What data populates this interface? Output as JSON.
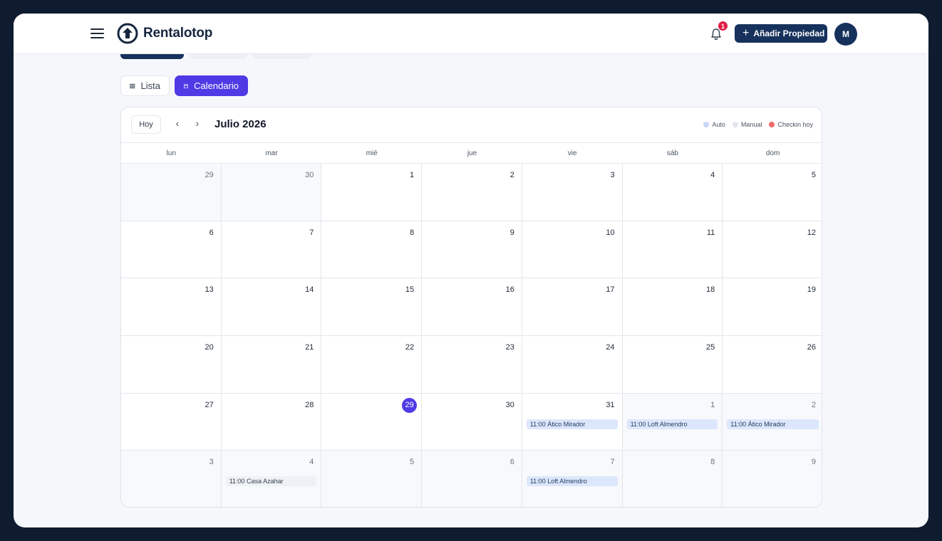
{
  "app": {
    "brand": "Rentalotop",
    "notifications_count": "1",
    "add_property_label": "Añadir Propiedad",
    "avatar_initial": "M"
  },
  "view_toggle": {
    "list_label": "Lista",
    "calendar_label": "Calendario",
    "active": "calendar"
  },
  "calendar": {
    "today_label": "Hoy",
    "prev_arrow": "‹",
    "next_arrow": "›",
    "month_title": "Julio 2026",
    "legend": [
      {
        "label": "Auto",
        "color": "#c9d6f6"
      },
      {
        "label": "Manual",
        "color": "#e2e5ea"
      },
      {
        "label": "Checkin hoy",
        "color": "#ef6b6b"
      }
    ],
    "weekdays": [
      "lun",
      "mar",
      "mié",
      "jue",
      "vie",
      "sáb",
      "dom"
    ],
    "days": [
      {
        "num": "29",
        "out": true
      },
      {
        "num": "30",
        "out": true
      },
      {
        "num": "1"
      },
      {
        "num": "2"
      },
      {
        "num": "3"
      },
      {
        "num": "4"
      },
      {
        "num": "5"
      },
      {
        "num": "6"
      },
      {
        "num": "7"
      },
      {
        "num": "8"
      },
      {
        "num": "9"
      },
      {
        "num": "10"
      },
      {
        "num": "11"
      },
      {
        "num": "12"
      },
      {
        "num": "13"
      },
      {
        "num": "14"
      },
      {
        "num": "15"
      },
      {
        "num": "16"
      },
      {
        "num": "17"
      },
      {
        "num": "18"
      },
      {
        "num": "19"
      },
      {
        "num": "20"
      },
      {
        "num": "21"
      },
      {
        "num": "22"
      },
      {
        "num": "23"
      },
      {
        "num": "24"
      },
      {
        "num": "25"
      },
      {
        "num": "26"
      },
      {
        "num": "27"
      },
      {
        "num": "28"
      },
      {
        "num": "29",
        "today": true
      },
      {
        "num": "30"
      },
      {
        "num": "31",
        "event": "11:00 Ático Mirador",
        "event_type": "auto"
      },
      {
        "num": "1",
        "out": true,
        "event": "11:00 Loft Almendro",
        "event_type": "auto"
      },
      {
        "num": "2",
        "out": true,
        "event": "11:00 Ático Mirador",
        "event_type": "auto"
      },
      {
        "num": "3",
        "out": true
      },
      {
        "num": "4",
        "out": true,
        "event": "11:00 Casa Azahar",
        "event_type": "manual"
      },
      {
        "num": "5",
        "out": true
      },
      {
        "num": "6",
        "out": true
      },
      {
        "num": "7",
        "out": true,
        "event": "11:00 Loft Almendro",
        "event_type": "auto"
      },
      {
        "num": "8",
        "out": true
      },
      {
        "num": "9",
        "out": true
      }
    ]
  }
}
